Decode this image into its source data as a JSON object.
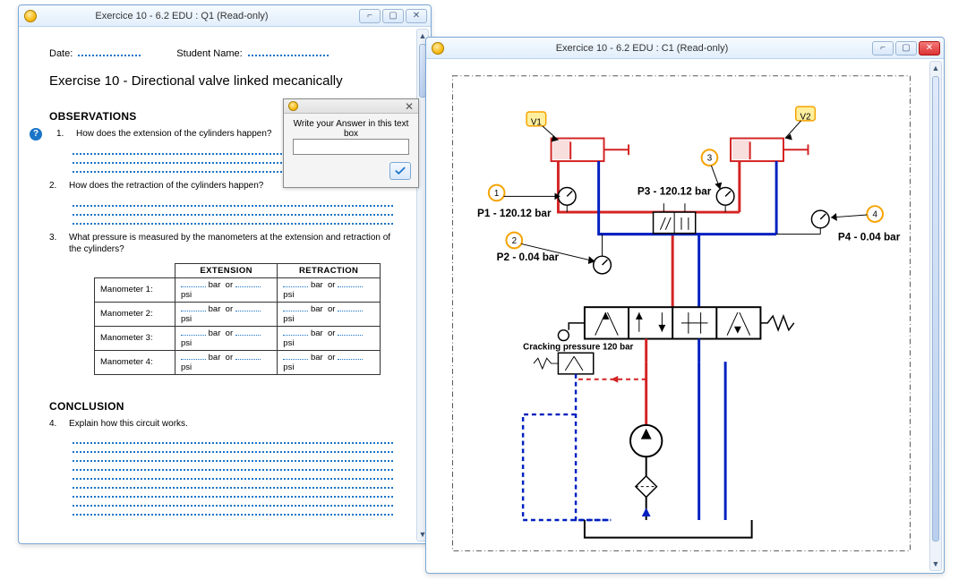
{
  "winQ": {
    "title": "Exercice 10 - 6.2 EDU : Q1 (Read-only)",
    "date_label": "Date:",
    "student_label": "Student Name:",
    "doc_title": "Exercise 10 -  Directional valve linked mecanically",
    "observations_head": "OBSERVATIONS",
    "conclusion_head": "CONCLUSION",
    "questions": {
      "q1": {
        "num": "1.",
        "text": "How does the extension of the cylinders happen?"
      },
      "q2": {
        "num": "2.",
        "text": "How does the retraction of the cylinders happen?"
      },
      "q3": {
        "num": "3.",
        "text": "What pressure is measured by the manometers at the extension and retraction of the cylinders?"
      },
      "q4": {
        "num": "4.",
        "text": "Explain how this circuit works."
      }
    },
    "table": {
      "col1": "EXTENSION",
      "col2": "RETRACTION",
      "rows": [
        "Manometer 1:",
        "Manometer 2:",
        "Manometer 3:",
        "Manometer 4:"
      ],
      "unit_bar": "bar",
      "unit_or": "or",
      "unit_psi": "psi"
    }
  },
  "popup": {
    "prompt": "Write your Answer in this text box"
  },
  "winC": {
    "title": "Exercice 10 - 6.2 EDU : C1 (Read-only)",
    "p1": "P1 - 120.12 bar",
    "p2": "P2 - 0.04 bar",
    "p3": "P3 - 120.12 bar",
    "p4": "P4 - 0.04 bar",
    "crack": "Cracking pressure 120 bar",
    "v1": "V1",
    "v2": "V2",
    "markers": {
      "m1": "1",
      "m2": "2",
      "m3": "3",
      "m4": "4"
    }
  }
}
